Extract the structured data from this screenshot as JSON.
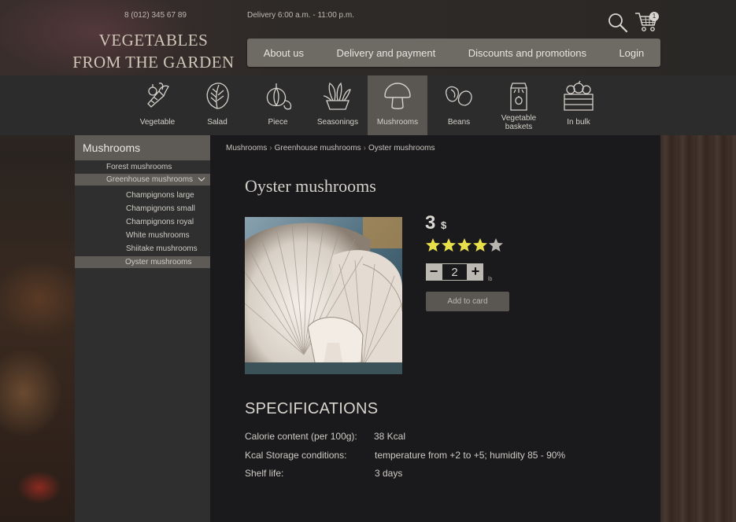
{
  "header": {
    "phone": "8 (012) 345 67 89",
    "delivery": "Delivery 6:00 a.m. - 11:00 p.m.",
    "logo_line1": "VEGETABLES",
    "logo_line2": "FROM THE GARDEN",
    "cart_count": "1",
    "nav": [
      "About us",
      "Delivery and payment",
      "Discounts and promotions",
      "Login"
    ]
  },
  "categories": [
    {
      "label": "Vegetable",
      "icon": "vegetable-icon"
    },
    {
      "label": "Salad",
      "icon": "salad-icon"
    },
    {
      "label": "Piece",
      "icon": "garlic-icon"
    },
    {
      "label": "Seasonings",
      "icon": "seasonings-icon"
    },
    {
      "label": "Mushrooms",
      "icon": "mushroom-icon",
      "active": true
    },
    {
      "label": "Beans",
      "icon": "beans-icon"
    },
    {
      "label": "Vegetable baskets",
      "icon": "basket-icon"
    },
    {
      "label": "In bulk",
      "icon": "crate-icon"
    }
  ],
  "sidebar": {
    "title": "Mushrooms",
    "items": [
      {
        "label": "Forest mushrooms"
      },
      {
        "label": "Greenhouse mushrooms",
        "expanded": true
      },
      {
        "label": "Champignons large"
      },
      {
        "label": "Champignons small"
      },
      {
        "label": "Champignons royal"
      },
      {
        "label": "White mushrooms"
      },
      {
        "label": "Shiitake mushrooms"
      },
      {
        "label": "Oyster mushrooms",
        "selected": true
      }
    ]
  },
  "breadcrumb": [
    "Mushrooms",
    "Greenhouse mushrooms",
    "Oyster mushrooms"
  ],
  "product": {
    "title": "Oyster mushrooms",
    "price": "3",
    "currency": "$",
    "rating": 4,
    "rating_max": 5,
    "quantity": "2",
    "unit": "lb",
    "add_label": "Add to card"
  },
  "specifications": {
    "title": "SPECIFICATIONS",
    "rows": [
      {
        "label": "Calorie content (per 100g):",
        "value": "38 Kcal"
      },
      {
        "label": "Kcal Storage conditions:",
        "value": "temperature from +2 to +5; humidity 85 - 90%"
      },
      {
        "label": "Shelf life:",
        "value": "3 days"
      }
    ]
  },
  "colors": {
    "star_on": "#e8e04a",
    "star_off": "#b8b4ae",
    "accent": "#5e5b56"
  }
}
